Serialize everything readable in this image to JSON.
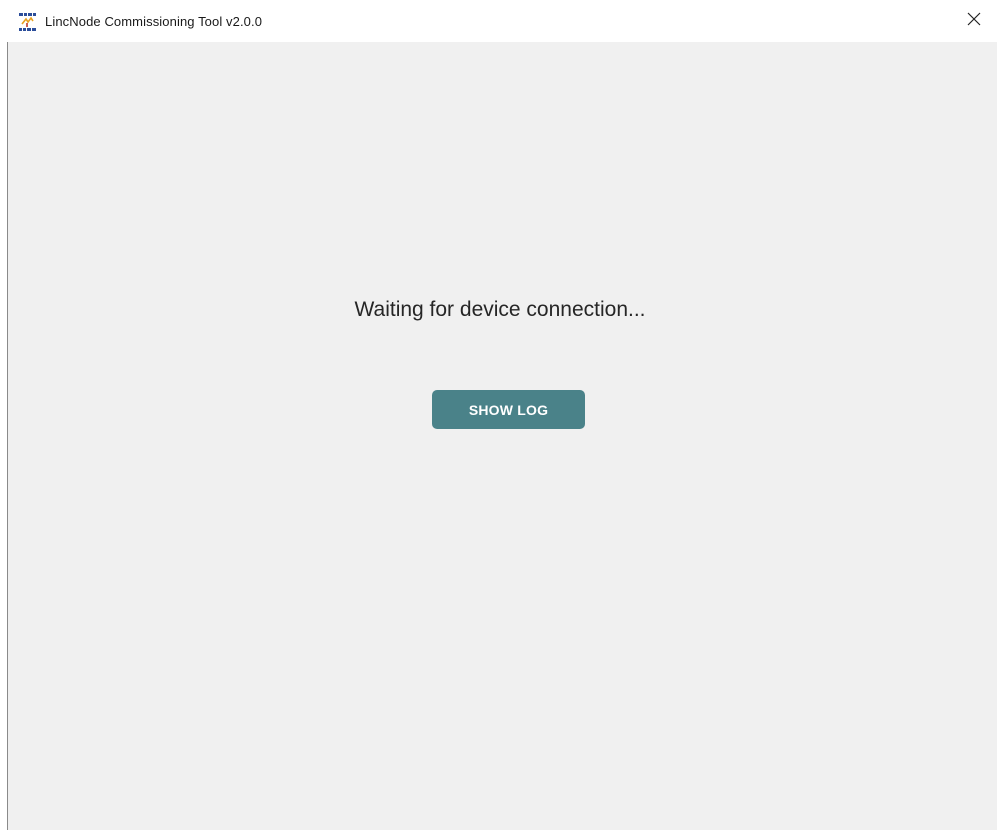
{
  "window": {
    "title": "LincNode Commissioning Tool v2.0.0",
    "app_icon": "lincnode-logo-icon",
    "close_icon": "close-icon",
    "accent_color": "#4a8289",
    "background_color": "#f0f0f0"
  },
  "main": {
    "status_message": "Waiting for device connection...",
    "show_log_label": "SHOW LOG"
  }
}
